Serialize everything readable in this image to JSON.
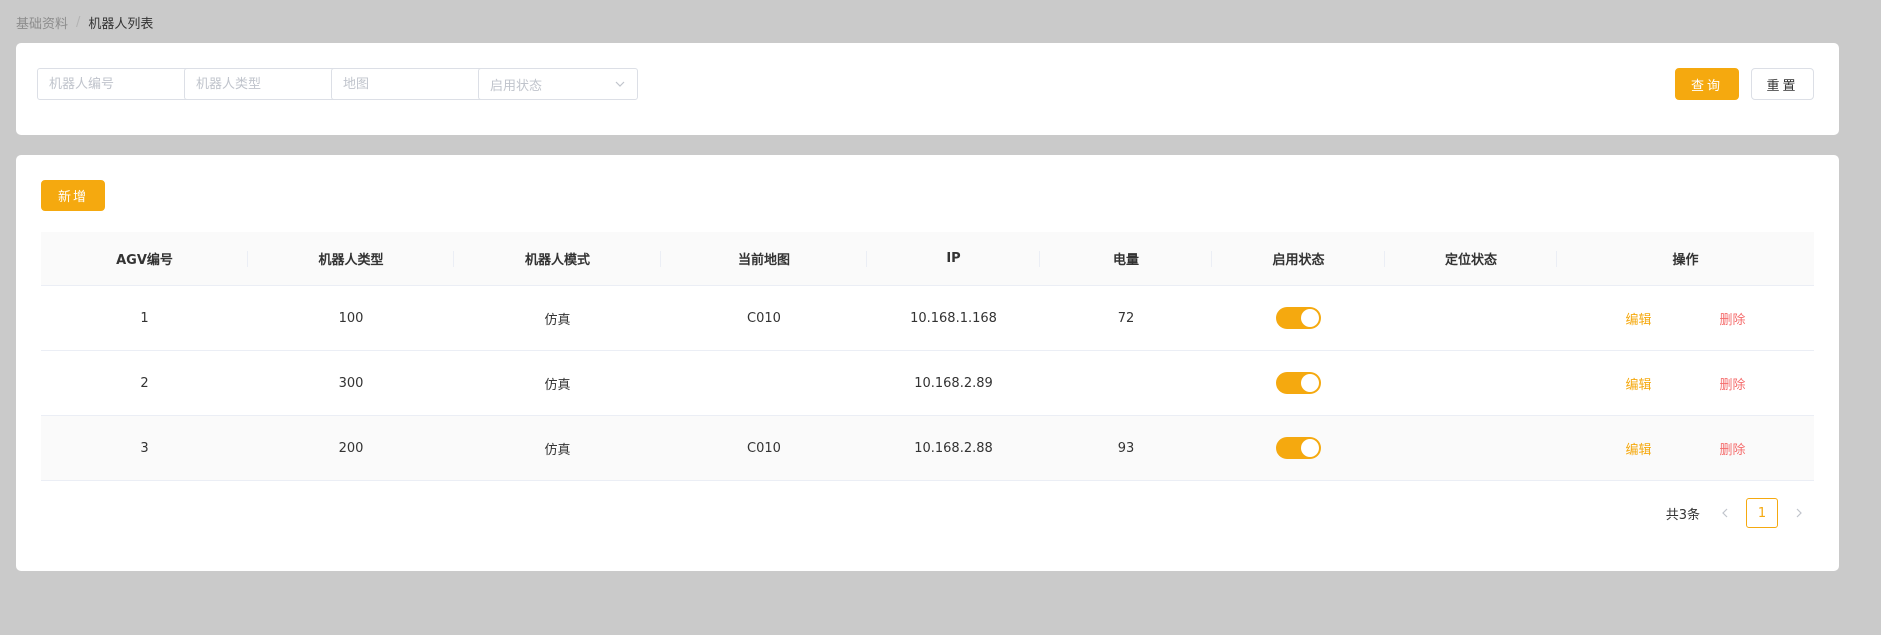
{
  "breadcrumb": {
    "parent": "基础资料",
    "separator": "/",
    "current": "机器人列表"
  },
  "filters": {
    "robot_no_placeholder": "机器人编号",
    "robot_type_placeholder": "机器人类型",
    "map_placeholder": "地图",
    "status_placeholder": "启用状态",
    "query_label": "查询",
    "reset_label": "重置"
  },
  "toolbar": {
    "add_label": "新增"
  },
  "table": {
    "headers": [
      "AGV编号",
      "机器人类型",
      "机器人模式",
      "当前地图",
      "IP",
      "电量",
      "启用状态",
      "定位状态",
      "操作"
    ],
    "rows": [
      {
        "agv_no": "1",
        "type": "100",
        "mode": "仿真",
        "map": "C010",
        "ip": "10.168.1.168",
        "battery": "72",
        "enabled": true,
        "location": "",
        "edit": "编辑",
        "delete": "删除"
      },
      {
        "agv_no": "2",
        "type": "300",
        "mode": "仿真",
        "map": "",
        "ip": "10.168.2.89",
        "battery": "",
        "enabled": true,
        "location": "",
        "edit": "编辑",
        "delete": "删除"
      },
      {
        "agv_no": "3",
        "type": "200",
        "mode": "仿真",
        "map": "C010",
        "ip": "10.168.2.88",
        "battery": "93",
        "enabled": true,
        "location": "",
        "edit": "编辑",
        "delete": "删除"
      }
    ]
  },
  "pagination": {
    "total_text": "共3条",
    "current_page": "1"
  },
  "colors": {
    "accent": "#f5a90f",
    "danger": "#f56c6c",
    "background": "#cacaca"
  }
}
